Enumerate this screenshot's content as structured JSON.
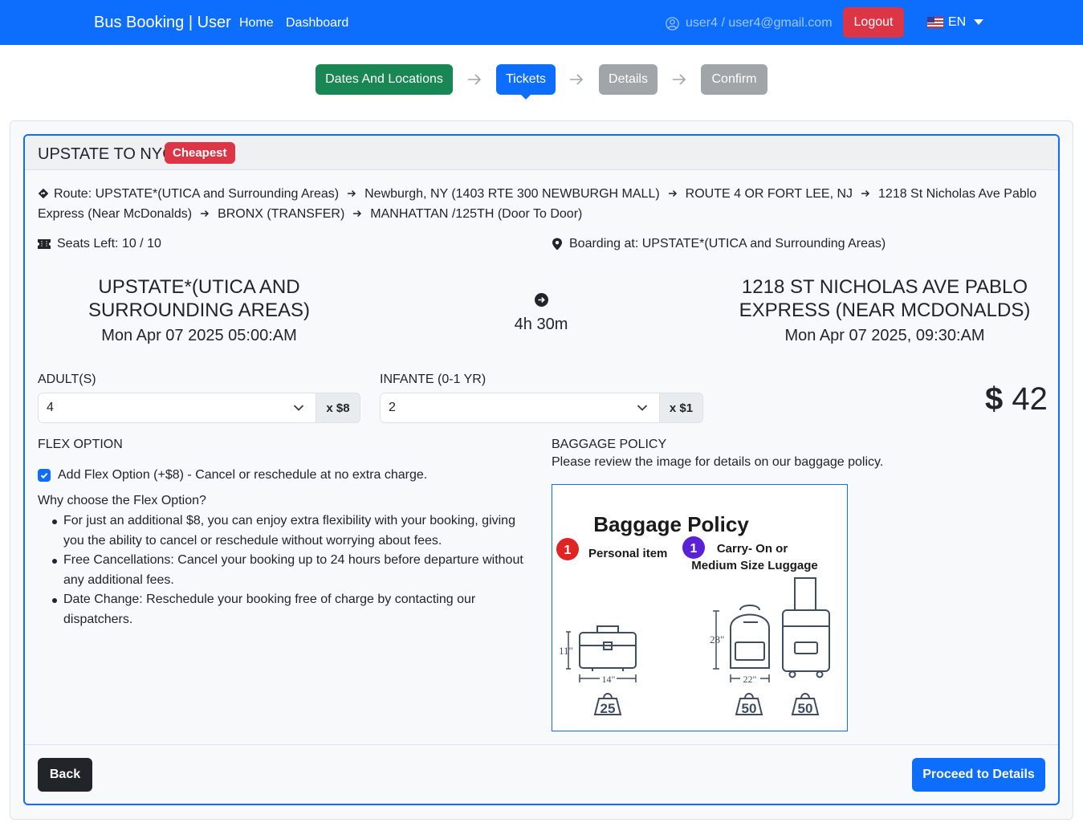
{
  "navbar": {
    "brand": "Bus Booking | User",
    "links": [
      "Home",
      "Dashboard"
    ],
    "user": "user4 / user4@gmail.com",
    "logout_label": "Logout",
    "language": "EN"
  },
  "stepper": {
    "steps": [
      "Dates And Locations",
      "Tickets",
      "Details",
      "Confirm"
    ],
    "active_step": "Tickets"
  },
  "trip": {
    "title": "UPSTATE TO NYC",
    "badge": "Cheapest",
    "route_label": "Route:",
    "route_stops": [
      "UPSTATE*(UTICA and Surrounding Areas)",
      "Newburgh, NY (1403 RTE 300 NEWBURGH MALL)",
      "ROUTE 4 OR FORT LEE, NJ",
      "1218 St Nicholas Ave Pablo Express (Near McDonalds)",
      "BRONX (TRANSFER)",
      "MANHATTAN /125TH (Door To Door)"
    ],
    "seats_left": "Seats Left: 10 / 10",
    "boarding": "Boarding at: UPSTATE*(UTICA and Surrounding Areas)",
    "departure_city": "UPSTATE*(UTICA AND SURROUNDING AREAS)",
    "departure_time": "Mon Apr 07 2025 05:00:AM",
    "duration": "4h 30m",
    "arrival_city": "1218 ST NICHOLAS AVE PABLO EXPRESS (NEAR MCDONALDS)",
    "arrival_time": "Mon Apr 07 2025, 09:30:AM"
  },
  "tickets": {
    "adult_label": "ADULT(S)",
    "adult_value": "4",
    "adult_price": "x $8",
    "infant_label": "INFANTE (0-1 YR)",
    "infant_value": "2",
    "infant_price": "x $1",
    "total_currency": "$",
    "total_amount": "42"
  },
  "flex": {
    "title": "FLEX OPTION",
    "checkbox_label": "Add Flex Option (+$8) - Cancel or reschedule at no extra charge.",
    "checked": true,
    "why_title": "Why choose the Flex Option?",
    "reasons": [
      "For just an additional $8, you can enjoy extra flexibility with your booking, giving you the ability to cancel or reschedule without worrying about fees.",
      "Free Cancellations: Cancel your booking up to 24 hours before departure without any additional fees.",
      "Date Change: Reschedule your booking free of charge by contacting our dispatchers."
    ]
  },
  "baggage": {
    "title": "BAGGAGE POLICY",
    "description": "Please review the image for details on our baggage policy.",
    "image": {
      "heading": "Baggage Policy",
      "personal_count": "1",
      "personal_label": "Personal item",
      "carry_count": "1",
      "carry_label_1": "Carry- On or",
      "carry_label_2": "Medium Size Luggage",
      "personal_height": "11\"",
      "personal_width": "14\"",
      "personal_weight": "25",
      "carry_height": "28\"",
      "carry_width": "22\"",
      "carry_weight_1": "50",
      "carry_weight_2": "50"
    }
  },
  "actions": {
    "back_label": "Back",
    "proceed_label": "Proceed to Details"
  },
  "colors": {
    "primary": "#0d6efd",
    "success": "#198754",
    "danger": "#dc3545",
    "disabled": "#a0a5aa",
    "dark": "#212529"
  }
}
